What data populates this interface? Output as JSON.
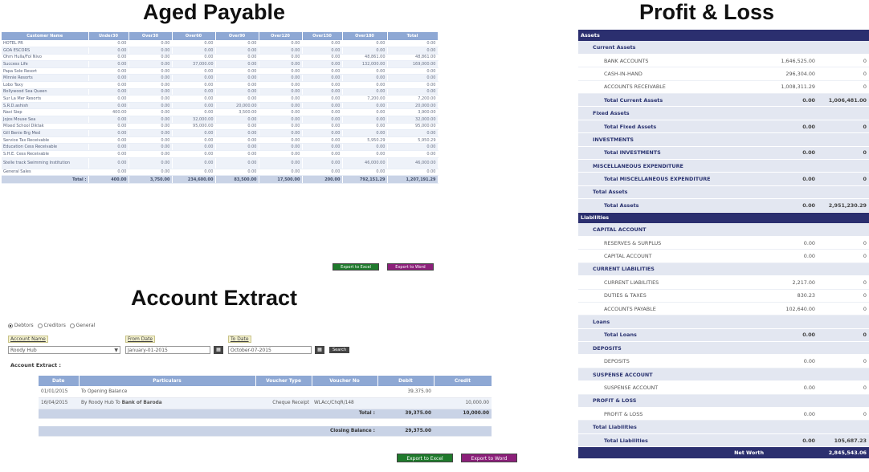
{
  "titles": {
    "aged_payable": "Aged Payable",
    "account_extract": "Account Extract",
    "profit_loss": "Profit & Loss"
  },
  "aged_payable": {
    "columns": [
      "Customer Name",
      "Under30",
      "Over30",
      "Over60",
      "Over90",
      "Over120",
      "Over150",
      "Over180",
      "Total"
    ],
    "rows": [
      [
        "HOTEL PR",
        "0.00",
        "0.00",
        "0.00",
        "0.00",
        "0.00",
        "0.00",
        "0.00",
        "0.00"
      ],
      [
        "GOA ESCORS",
        "0.00",
        "0.00",
        "0.00",
        "0.00",
        "0.00",
        "0.00",
        "0.00",
        "0.00"
      ],
      [
        "Ohm Hulla/Fol Nivo",
        "0.00",
        "0.00",
        "0.00",
        "0.00",
        "0.00",
        "0.00",
        "48,861.00",
        "48,861.00"
      ],
      [
        "Success Life",
        "0.00",
        "0.00",
        "37,000.00",
        "0.00",
        "0.00",
        "0.00",
        "132,000.00",
        "169,000.00"
      ],
      [
        "Papa Sole Resort",
        "0.00",
        "0.00",
        "0.00",
        "0.00",
        "0.00",
        "0.00",
        "0.00",
        "0.00"
      ],
      [
        "Minnie Resorts",
        "0.00",
        "0.00",
        "0.00",
        "0.00",
        "0.00",
        "0.00",
        "0.00",
        "0.00"
      ],
      [
        "Lobo Taxy",
        "0.00",
        "0.00",
        "0.00",
        "0.00",
        "0.00",
        "0.00",
        "0.00",
        "0.00"
      ],
      [
        "Bollywood Sea Queen",
        "0.00",
        "0.00",
        "0.00",
        "0.00",
        "0.00",
        "0.00",
        "0.00",
        "0.00"
      ],
      [
        "Sur La Mer Resorts",
        "0.00",
        "0.00",
        "0.00",
        "0.00",
        "0.00",
        "0.00",
        "7,200.00",
        "7,200.00"
      ],
      [
        "S.R.D.ashish",
        "0.00",
        "0.00",
        "0.00",
        "20,000.00",
        "0.00",
        "0.00",
        "0.00",
        "20,000.00"
      ],
      [
        "Navi Siep",
        "400.00",
        "0.00",
        "0.00",
        "3,500.00",
        "0.00",
        "0.00",
        "0.00",
        "3,900.00"
      ],
      [
        "Jojos Mouse Sea",
        "0.00",
        "0.00",
        "32,000.00",
        "0.00",
        "0.00",
        "0.00",
        "0.00",
        "32,000.00"
      ],
      [
        "Mixed School Diktak",
        "0.00",
        "0.00",
        "95,000.00",
        "0.00",
        "0.00",
        "0.00",
        "0.00",
        "95,000.00"
      ],
      [
        "Gill Benie Brg Med",
        "0.00",
        "0.00",
        "0.00",
        "0.00",
        "0.00",
        "0.00",
        "0.00",
        "0.00"
      ],
      [
        "Service Tax Receivable",
        "0.00",
        "0.00",
        "0.00",
        "0.00",
        "0.00",
        "0.00",
        "5,950.29",
        "5,950.29"
      ],
      [
        "Education Cess Receivable",
        "0.00",
        "0.00",
        "0.00",
        "0.00",
        "0.00",
        "0.00",
        "0.00",
        "0.00"
      ],
      [
        "S.H.E. Cess Receivable",
        "0.00",
        "0.00",
        "0.00",
        "0.00",
        "0.00",
        "0.00",
        "0.00",
        "0.00"
      ],
      [
        "Stelle track Swimming Institution",
        "0.00",
        "0.00",
        "0.00",
        "0.00",
        "0.00",
        "0.00",
        "46,000.00",
        "46,000.00"
      ],
      [
        "General Sales",
        "0.00",
        "0.00",
        "0.00",
        "0.00",
        "0.00",
        "0.00",
        "0.00",
        "0.00"
      ]
    ],
    "total": [
      "Total :",
      "400.00",
      "3,750.00",
      "234,600.00",
      "83,500.00",
      "17,500.00",
      "200.00",
      "792,151.29",
      "1,207,191.29"
    ],
    "export_excel": "Export to Excel",
    "export_word": "Export to Word"
  },
  "account_extract": {
    "radio_debtors": "Debtors",
    "radio_creditors": "Creditors",
    "radio_general": "General",
    "account_name_label": "Account Name",
    "account_name_value": "Roody Hub",
    "from_date_label": "From Date",
    "from_date_value": "January-01-2015",
    "to_date_label": "To Date",
    "to_date_value": "October-07-2015",
    "search": "Search",
    "extract_label": "Account Extract :",
    "columns": [
      "Date",
      "Particulars",
      "Voucher Type",
      "Voucher No",
      "Debit",
      "Credit"
    ],
    "rows": [
      {
        "date": "01/01/2015",
        "particulars": "To Opening Balance",
        "bold": "",
        "vtype": "",
        "vno": "",
        "debit": "39,375.00",
        "credit": ""
      },
      {
        "date": "16/04/2015",
        "particulars": "By Roody Hub To ",
        "bold": "Bank of Baroda",
        "vtype": "Cheque Receipt",
        "vno": "WLAcc/ChqR/148",
        "debit": "",
        "credit": "10,000.00"
      }
    ],
    "total_label": "Total :",
    "total_debit": "39,375.00",
    "total_credit": "10,000.00",
    "closing_label": "Closing Balance :",
    "closing_value": "29,375.00",
    "export_excel": "Export to Excel",
    "export_word": "Export to Word"
  },
  "profit_loss": {
    "rows": [
      {
        "type": "hdr",
        "label": "Assets",
        "v1": "",
        "v2": "",
        "indent": 0
      },
      {
        "type": "sec",
        "label": "Current Assets",
        "v1": "",
        "v2": "",
        "indent": 1
      },
      {
        "type": "item",
        "label": "BANK ACCOUNTS",
        "v1": "1,646,525.00",
        "v2": "0",
        "indent": 2
      },
      {
        "type": "item",
        "label": "CASH-IN-HAND",
        "v1": "296,304.00",
        "v2": "0",
        "indent": 2
      },
      {
        "type": "item",
        "label": "ACCOUNTS RECEIVABLE",
        "v1": "1,008,311.29",
        "v2": "0",
        "indent": 2
      },
      {
        "type": "totl",
        "label": "Total Current Assets",
        "v1": "0.00",
        "v2": "1,006,481.00",
        "indent": 2
      },
      {
        "type": "sec",
        "label": "Fixed Assets",
        "v1": "",
        "v2": "",
        "indent": 1
      },
      {
        "type": "totl",
        "label": "Total Fixed Assets",
        "v1": "0.00",
        "v2": "0",
        "indent": 2
      },
      {
        "type": "sec",
        "label": "INVESTMENTS",
        "v1": "",
        "v2": "",
        "indent": 1
      },
      {
        "type": "totl",
        "label": "Total INVESTMENTS",
        "v1": "0.00",
        "v2": "0",
        "indent": 2
      },
      {
        "type": "sec",
        "label": "MISCELLANEOUS EXPENDITURE",
        "v1": "",
        "v2": "",
        "indent": 1
      },
      {
        "type": "totl",
        "label": "Total MISCELLANEOUS EXPENDITURE",
        "v1": "0.00",
        "v2": "0",
        "indent": 2
      },
      {
        "type": "sec",
        "label": "Total Assets",
        "v1": "",
        "v2": "",
        "indent": 1
      },
      {
        "type": "totl",
        "label": "Total Assets",
        "v1": "0.00",
        "v2": "2,951,230.29",
        "indent": 2
      },
      {
        "type": "hdr",
        "label": "Liabilities",
        "v1": "",
        "v2": "",
        "indent": 0
      },
      {
        "type": "sec",
        "label": "CAPITAL ACCOUNT",
        "v1": "",
        "v2": "",
        "indent": 1
      },
      {
        "type": "item",
        "label": "RESERVES & SURPLUS",
        "v1": "0.00",
        "v2": "0",
        "indent": 2
      },
      {
        "type": "item",
        "label": "CAPITAL ACCOUNT",
        "v1": "0.00",
        "v2": "0",
        "indent": 2
      },
      {
        "type": "sec",
        "label": "CURRENT LIABILITIES",
        "v1": "",
        "v2": "",
        "indent": 1
      },
      {
        "type": "item",
        "label": "CURRENT LIABILITIES",
        "v1": "2,217.00",
        "v2": "0",
        "indent": 2
      },
      {
        "type": "item",
        "label": "DUTIES & TAXES",
        "v1": "830.23",
        "v2": "0",
        "indent": 2
      },
      {
        "type": "item",
        "label": "ACCOUNTS PAYABLE",
        "v1": "102,640.00",
        "v2": "0",
        "indent": 2
      },
      {
        "type": "sec",
        "label": "Loans",
        "v1": "",
        "v2": "",
        "indent": 1
      },
      {
        "type": "totl",
        "label": "Total Loans",
        "v1": "0.00",
        "v2": "0",
        "indent": 2
      },
      {
        "type": "sec",
        "label": "DEPOSITS",
        "v1": "",
        "v2": "",
        "indent": 1
      },
      {
        "type": "item",
        "label": "DEPOSITS",
        "v1": "0.00",
        "v2": "0",
        "indent": 2
      },
      {
        "type": "sec",
        "label": "SUSPENSE ACCOUNT",
        "v1": "",
        "v2": "",
        "indent": 1
      },
      {
        "type": "item",
        "label": "SUSPENSE ACCOUNT",
        "v1": "0.00",
        "v2": "0",
        "indent": 2
      },
      {
        "type": "sec",
        "label": "PROFIT & LOSS",
        "v1": "",
        "v2": "",
        "indent": 1
      },
      {
        "type": "item",
        "label": "PROFIT & LOSS",
        "v1": "0.00",
        "v2": "0",
        "indent": 2
      },
      {
        "type": "sec",
        "label": "Total Liabilities",
        "v1": "",
        "v2": "",
        "indent": 1
      },
      {
        "type": "totl",
        "label": "Total Liabilities",
        "v1": "0.00",
        "v2": "105,687.23",
        "indent": 2
      },
      {
        "type": "hdr",
        "label": "Net Worth",
        "v1": "",
        "v2": "2,845,543.06",
        "indent": 0,
        "net": true
      }
    ]
  },
  "colors": {
    "header_blue": "#8ea8d4",
    "navy": "#2b2f6f",
    "green_button": "#1f7a2c",
    "purple_button": "#8c1f7a"
  },
  "icons": {
    "calendar": "calendar-icon",
    "dropdown": "chevron-down-icon"
  }
}
